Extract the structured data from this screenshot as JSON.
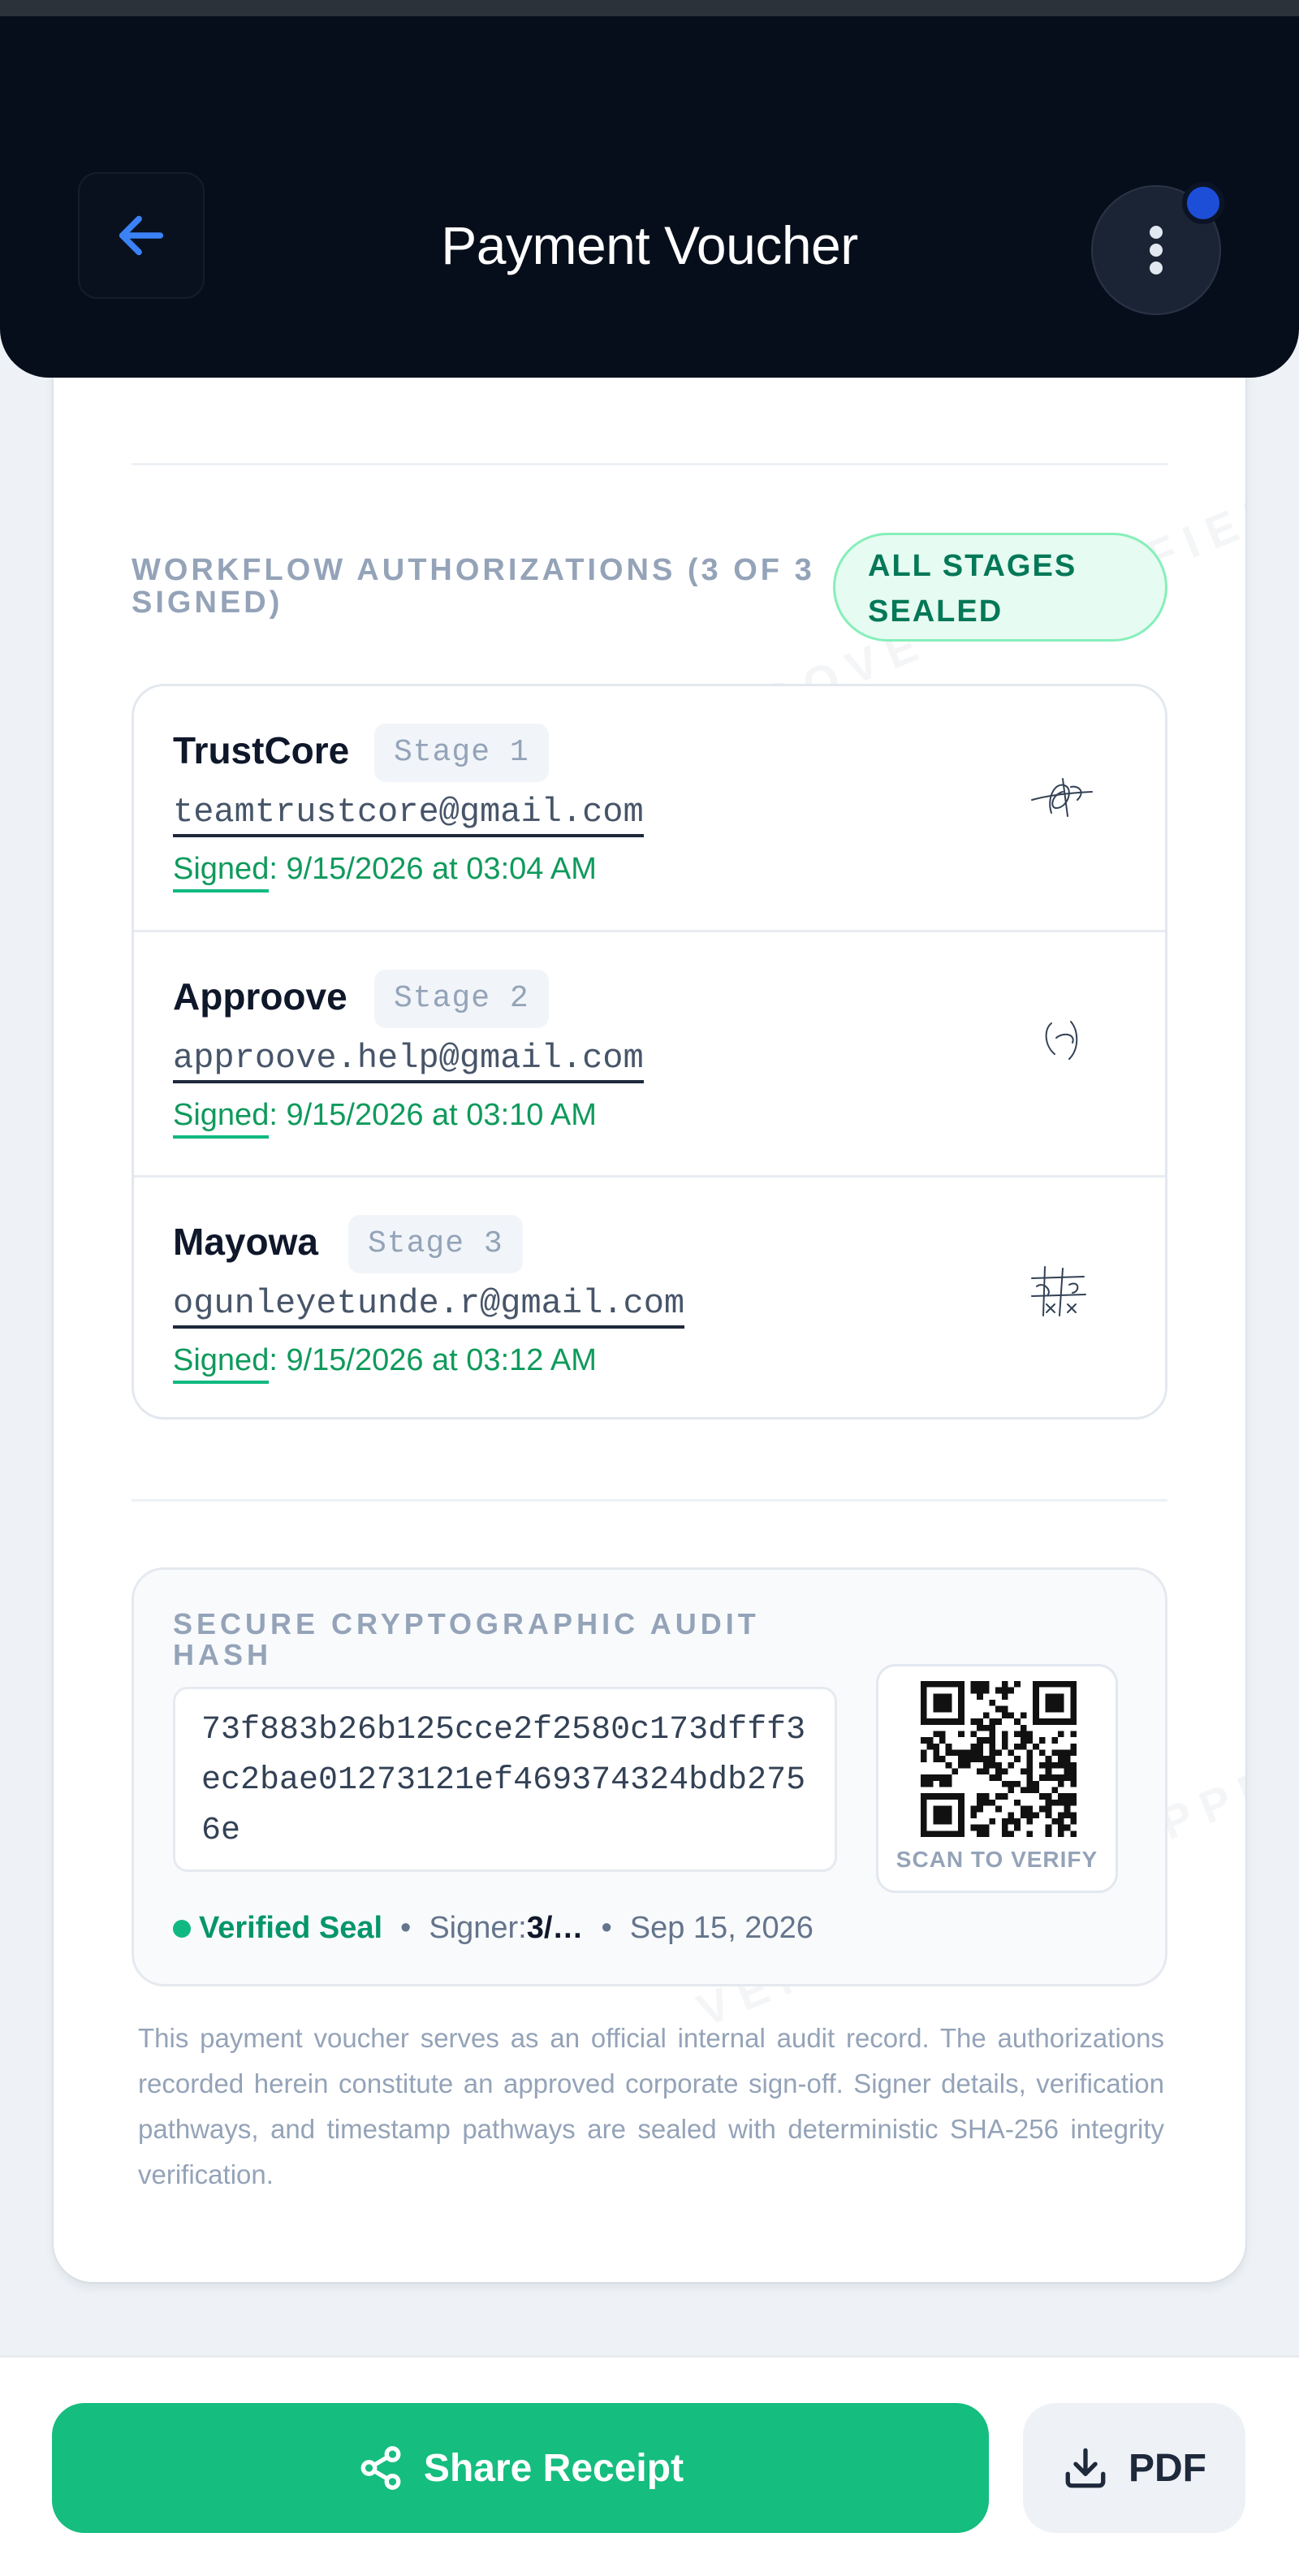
{
  "header": {
    "title": "Payment Voucher",
    "back_icon": "arrow-left-icon",
    "menu_icon": "more-vertical-icon"
  },
  "watermark": "VERIFIED VIA APPROOVE",
  "workflow": {
    "title": "WORKFLOW AUTHORIZATIONS (3 OF 3 SIGNED)",
    "badge": "ALL STAGES SEALED",
    "signers": [
      {
        "name": "TrustCore",
        "stage": "Stage 1",
        "email": "teamtrustcore@gmail.com",
        "signed_label": "Signed",
        "signed_value": ": 9/15/2026 at 03:04 AM"
      },
      {
        "name": "Approove",
        "stage": "Stage 2",
        "email": "approove.help@gmail.com",
        "signed_label": "Signed",
        "signed_value": ": 9/15/2026 at 03:10 AM"
      },
      {
        "name": "Mayowa",
        "stage": "Stage 3",
        "email": "ogunleyetunde.r@gmail.com",
        "signed_label": "Signed",
        "signed_value": ": 9/15/2026 at 03:12 AM"
      }
    ]
  },
  "audit": {
    "title": "SECURE CRYPTOGRAPHIC AUDIT HASH",
    "hash": "73f883b26b125cce2f2580c173dfff3ec2bae01273121ef469374324bdb2756e",
    "qr_caption": "SCAN TO VERIFY",
    "status": "Verified Seal",
    "signer_label": "Signer: ",
    "signer_value": "3/…",
    "date": "Sep 15, 2026"
  },
  "disclaimer": "This payment voucher serves as an official internal audit record. The authorizations recorded herein constitute an approved corporate sign-off. Signer details, verification pathways, and timestamp pathways are sealed with deterministic SHA-256 integrity verification.",
  "actions": {
    "share_label": "Share Receipt",
    "share_icon": "share-icon",
    "pdf_label": "PDF",
    "pdf_icon": "download-icon"
  },
  "colors": {
    "header_bg": "#070e1b",
    "accent_green": "#15bd7f",
    "link_blue": "#3b82f6"
  }
}
